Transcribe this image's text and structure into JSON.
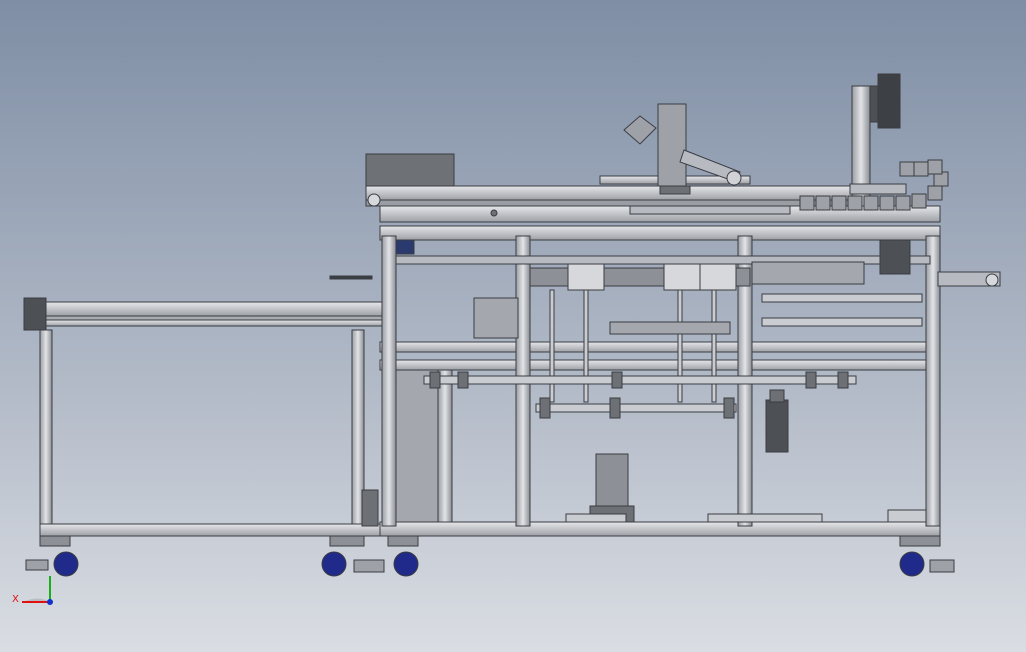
{
  "triad": {
    "x_label": "X"
  },
  "colors": {
    "bg_top": "#7f8ea5",
    "bg_bottom": "#d9dde4",
    "frame": "#c9ccd1",
    "frame_dark": "#8d9096",
    "line": "#3a3d42",
    "dark": "#4d5055",
    "wheel": "#1f2a8a",
    "axis_x": "#e01010",
    "axis_y": "#18b018",
    "axis_z": "#1030d0"
  }
}
